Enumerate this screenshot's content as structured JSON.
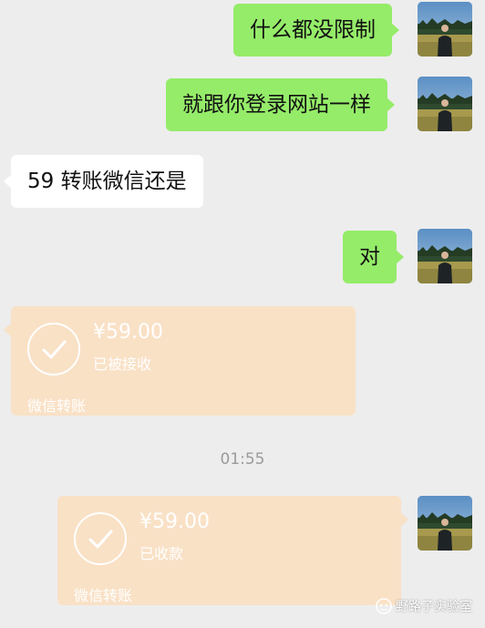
{
  "messages": [
    {
      "side": "right",
      "text": "什么都没限制"
    },
    {
      "side": "right",
      "text": "就跟你登录网站一样"
    },
    {
      "side": "left",
      "text": "59 转账微信还是"
    },
    {
      "side": "right",
      "text": "对"
    }
  ],
  "transfer_received": {
    "amount": "¥59.00",
    "status": "已被接收",
    "label": "微信转账"
  },
  "timestamp": "01:55",
  "transfer_collected": {
    "amount": "¥59.00",
    "status": "已收款",
    "label": "微信转账"
  },
  "watermark": {
    "text": "野路子实验室",
    "icon": "wechat-channel-icon"
  },
  "colors": {
    "background": "#ededed",
    "green_bubble": "#95ec69",
    "white_bubble": "#ffffff",
    "transfer_card": "#f9e1c6"
  }
}
